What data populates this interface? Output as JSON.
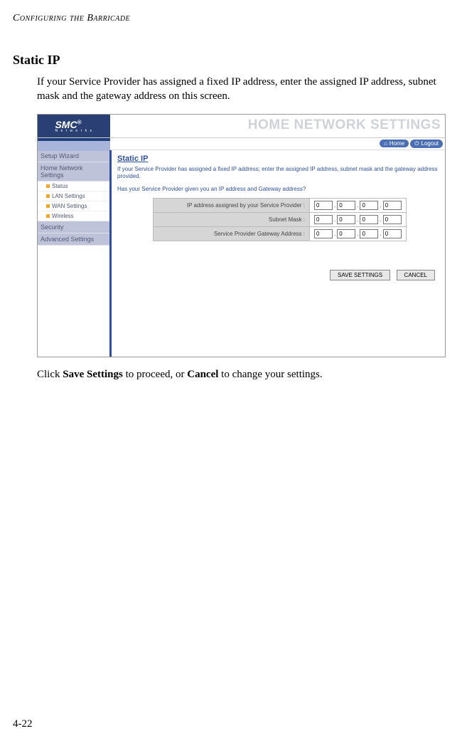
{
  "doc": {
    "header": "Configuring the Barricade",
    "section_title": "Static IP",
    "intro": "If your Service Provider has assigned a fixed IP address, enter the assigned IP address, subnet mask and the gateway address on this screen.",
    "outro_pre": "Click ",
    "outro_b1": "Save Settings",
    "outro_mid": " to proceed, or ",
    "outro_b2": "Cancel",
    "outro_post": " to change your settings.",
    "page_number": "4-22"
  },
  "ui": {
    "logo_text": "SMC",
    "logo_reg": "®",
    "logo_sub": "N e t w o r k s",
    "banner_title": "HOME NETWORK SETTINGS",
    "util": {
      "home": "Home",
      "logout": "Logout"
    },
    "nav": {
      "setup_wizard": "Setup Wizard",
      "home_net": "Home Network Settings",
      "status": "Status",
      "lan": "LAN Settings",
      "wan": "WAN Settings",
      "wireless": "Wireless",
      "security": "Security",
      "advanced": "Advanced Settings"
    },
    "content": {
      "heading": "Static IP",
      "desc": "If your Service Provider has assigned a fixed IP address; enter the assigned IP address, subnet mask and the gateway address provided.",
      "question": "Has your Service Provider given you an IP address and Gateway address?",
      "row1_label": "IP address assigned by your Service Provider :",
      "row2_label": "Subnet Mask :",
      "row3_label": "Service Provider Gateway Address :",
      "octet": "0",
      "save_btn": "SAVE SETTINGS",
      "cancel_btn": "CANCEL"
    }
  }
}
